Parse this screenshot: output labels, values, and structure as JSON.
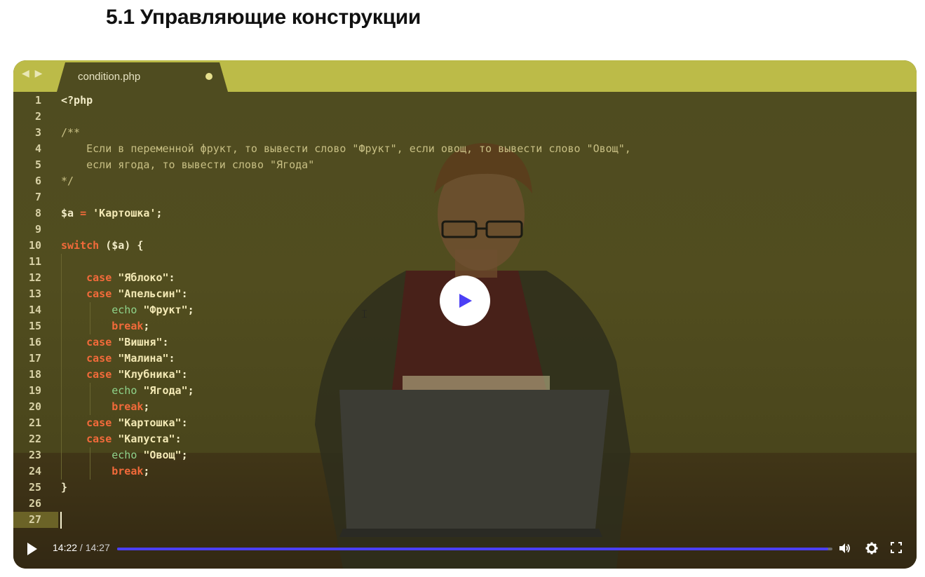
{
  "page": {
    "title": "5.1 Управляющие конструкции"
  },
  "editor": {
    "tab_filename": "condition.php",
    "nav_arrows": "◀ ▶",
    "lines": [
      {
        "n": "1",
        "html": "&lt;?php"
      },
      {
        "n": "2",
        "html": ""
      },
      {
        "n": "3",
        "html": "<span class='cm'>/**</span>"
      },
      {
        "n": "4",
        "html": "<span class='cm'>    Если в переменной фрукт, то вывести слово \"Фрукт\", если овощ, то вывести слово \"Овощ\",</span>"
      },
      {
        "n": "5",
        "html": "<span class='cm'>    если ягода, то вывести слово \"Ягода\"</span>"
      },
      {
        "n": "6",
        "html": "<span class='cm'>*/</span>"
      },
      {
        "n": "7",
        "html": ""
      },
      {
        "n": "8",
        "html": "$a <span class='op'>=</span> <span class='str'>'Картошка'</span>;"
      },
      {
        "n": "9",
        "html": ""
      },
      {
        "n": "10",
        "html": "<span class='kw'>switch</span> ($a) {"
      },
      {
        "n": "11",
        "html": ""
      },
      {
        "n": "12",
        "html": "    <span class='kw'>case</span> <span class='str'>\"Яблоко\"</span>:"
      },
      {
        "n": "13",
        "html": "    <span class='kw'>case</span> <span class='str'>\"Апельсин\"</span>:"
      },
      {
        "n": "14",
        "html": "        <span class='fn'>echo</span> <span class='str'>\"Фрукт\"</span>;"
      },
      {
        "n": "15",
        "html": "        <span class='kw'>break</span>;"
      },
      {
        "n": "16",
        "html": "    <span class='kw'>case</span> <span class='str'>\"Вишня\"</span>:"
      },
      {
        "n": "17",
        "html": "    <span class='kw'>case</span> <span class='str'>\"Малина\"</span>:"
      },
      {
        "n": "18",
        "html": "    <span class='kw'>case</span> <span class='str'>\"Клубника\"</span>:"
      },
      {
        "n": "19",
        "html": "        <span class='fn'>echo</span> <span class='str'>\"Ягода\"</span>;"
      },
      {
        "n": "20",
        "html": "        <span class='kw'>break</span>;"
      },
      {
        "n": "21",
        "html": "    <span class='kw'>case</span> <span class='str'>\"Картошка\"</span>:"
      },
      {
        "n": "22",
        "html": "    <span class='kw'>case</span> <span class='str'>\"Капуста\"</span>:"
      },
      {
        "n": "23",
        "html": "        <span class='fn'>echo</span> <span class='str'>\"Овощ\"</span>;"
      },
      {
        "n": "24",
        "html": "        <span class='kw'>break</span>;"
      },
      {
        "n": "25",
        "html": "}"
      },
      {
        "n": "26",
        "html": ""
      },
      {
        "n": "27",
        "html": ""
      }
    ],
    "current_line": "27"
  },
  "player": {
    "current_time": "14:22",
    "separator": " / ",
    "duration": "14:27",
    "progress_fraction": 0.994,
    "accent_color": "#4b3ff5",
    "icons": [
      "play-icon",
      "volume-icon",
      "settings-icon",
      "fullscreen-icon",
      "big-play-icon"
    ]
  }
}
